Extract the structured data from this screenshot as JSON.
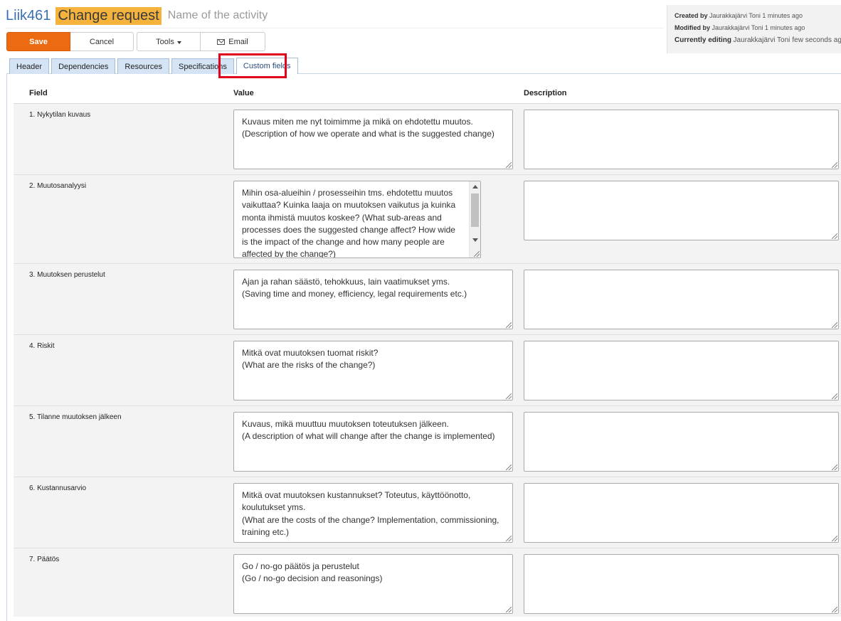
{
  "header": {
    "code": "Liik461",
    "type": "Change request",
    "name": "Name of the activity"
  },
  "meta": {
    "created_label": "Created by",
    "created_value": "Jaurakkajärvi Toni 1 minutes ago",
    "modified_label": "Modified by",
    "modified_value": "Jaurakkajärvi Toni 1 minutes ago",
    "editing_label": "Currently editing",
    "editing_value": "Jaurakkajärvi Toni",
    "editing_ago": "few seconds ago"
  },
  "toolbar": {
    "save": "Save",
    "cancel": "Cancel",
    "tools": "Tools",
    "email": "Email"
  },
  "tabs": [
    "Header",
    "Dependencies",
    "Resources",
    "Specifications",
    "Custom fields"
  ],
  "active_tab": "Custom fields",
  "table": {
    "col_field": "Field",
    "col_value": "Value",
    "col_description": "Description",
    "rows": [
      {
        "field": "1. Nykytilan kuvaus",
        "value": "Kuvaus miten me nyt toimimme ja mikä on ehdotettu muutos.\n(Description of how we operate and what is the suggested change)",
        "description": ""
      },
      {
        "field": "2. Muutosanalyysi",
        "value": "Mihin osa-alueihin / prosesseihin tms. ehdotettu muutos vaikuttaa? Kuinka laaja on muutoksen vaikutus ja kuinka monta ihmistä muutos koskee? (What sub-areas and processes does the suggested change affect? How wide is the impact of the change and how many people are affected by the change?)",
        "description": ""
      },
      {
        "field": "3. Muutoksen perustelut",
        "value": "Ajan ja rahan säästö, tehokkuus, lain vaatimukset yms.\n(Saving time and money, efficiency, legal requirements etc.)",
        "description": ""
      },
      {
        "field": "4. Riskit",
        "value": "Mitkä ovat muutoksen tuomat riskit?\n(What are the risks of the change?)",
        "description": ""
      },
      {
        "field": "5. Tilanne muutoksen jälkeen",
        "value": "Kuvaus, mikä muuttuu muutoksen toteutuksen jälkeen.\n(A description of what will change after the change is implemented)",
        "description": ""
      },
      {
        "field": "6. Kustannusarvio",
        "value": "Mitkä ovat muutoksen kustannukset? Toteutus, käyttöönotto, koulutukset yms.\n(What are the costs of the change? Implementation, commissioning, training etc.)",
        "description": ""
      },
      {
        "field": "7. Päätös",
        "value": "Go / no-go päätös ja perustelut\n(Go / no-go decision and reasonings)",
        "description": ""
      }
    ]
  },
  "colors": {
    "save_button": "#ec6b12",
    "type_badge": "#f5b33d",
    "code_text": "#3a6fb5",
    "tab_background": "#d5e4f5",
    "highlight": "#e3001b",
    "row_background": "#f3f3f3"
  }
}
